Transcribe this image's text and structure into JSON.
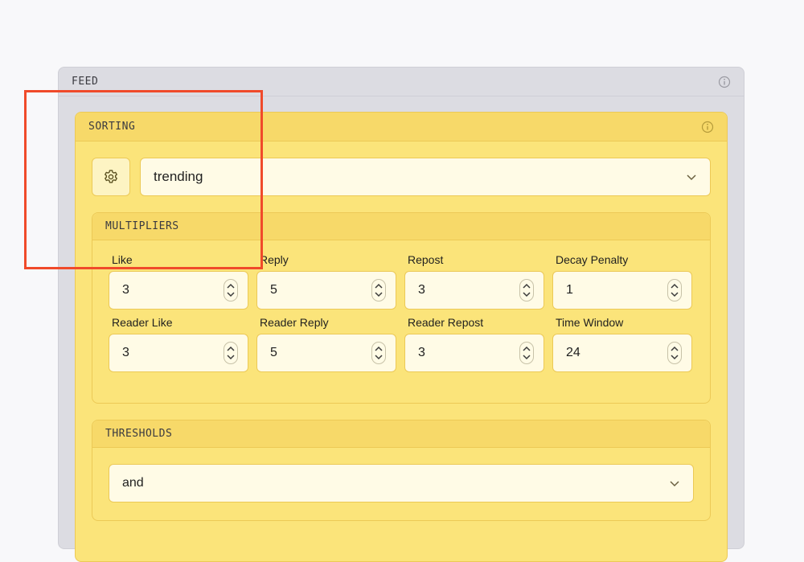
{
  "feed": {
    "title": "FEED",
    "info_icon": "info-icon"
  },
  "sorting": {
    "title": "SORTING",
    "info_icon": "info-icon",
    "settings_icon": "gear-icon",
    "selected": "trending",
    "dropdown_icon": "chevron-down-icon"
  },
  "multipliers": {
    "title": "MULTIPLIERS",
    "fields": [
      {
        "label": "Like",
        "value": "3"
      },
      {
        "label": "Reply",
        "value": "5"
      },
      {
        "label": "Repost",
        "value": "3"
      },
      {
        "label": "Decay Penalty",
        "value": "1"
      },
      {
        "label": "Reader Like",
        "value": "3"
      },
      {
        "label": "Reader Reply",
        "value": "5"
      },
      {
        "label": "Reader Repost",
        "value": "3"
      },
      {
        "label": "Time Window",
        "value": "24"
      }
    ]
  },
  "thresholds": {
    "title": "THRESHOLDS",
    "selected": "and",
    "dropdown_icon": "chevron-down-icon"
  },
  "colors": {
    "page_background": "#f8f8fa",
    "feed_panel": "#dcdce2",
    "sorting_panel": "#fbe47a",
    "input_background": "#fffbe6",
    "highlight": "#f04a2a"
  }
}
